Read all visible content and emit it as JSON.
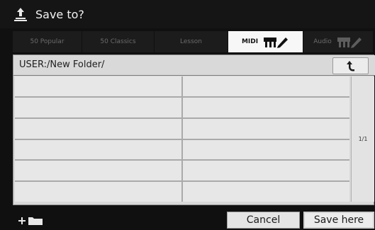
{
  "title": {
    "text": "Save to?",
    "icon": "save-to-icon"
  },
  "tabs": [
    {
      "label": "50 Popular",
      "active": false,
      "has_icon": false
    },
    {
      "label": "50 Classics",
      "active": false,
      "has_icon": false
    },
    {
      "label": "Lesson",
      "active": false,
      "has_icon": false
    },
    {
      "label": "MIDI",
      "active": true,
      "has_icon": true,
      "icon": "keyboard-pencil-icon"
    },
    {
      "label": "Audio",
      "active": false,
      "has_icon": true,
      "icon": "keyboard-pencil-icon"
    }
  ],
  "path": {
    "text": "USER:/New Folder/"
  },
  "up_button": {
    "icon": "folder-up-icon"
  },
  "file_grid": {
    "columns": 2,
    "rows": 6,
    "items": []
  },
  "page_indicator": {
    "text": "1/1"
  },
  "bottom": {
    "new_folder_icon": "new-folder-icon",
    "cancel_label": "Cancel",
    "save_label": "Save here"
  },
  "colors": {
    "background": "#101010",
    "panel": "#d9d9d9",
    "tab_active": "#f7f7f7",
    "tab_inactive": "#1c1c1c",
    "button": "#e5e5e5"
  }
}
